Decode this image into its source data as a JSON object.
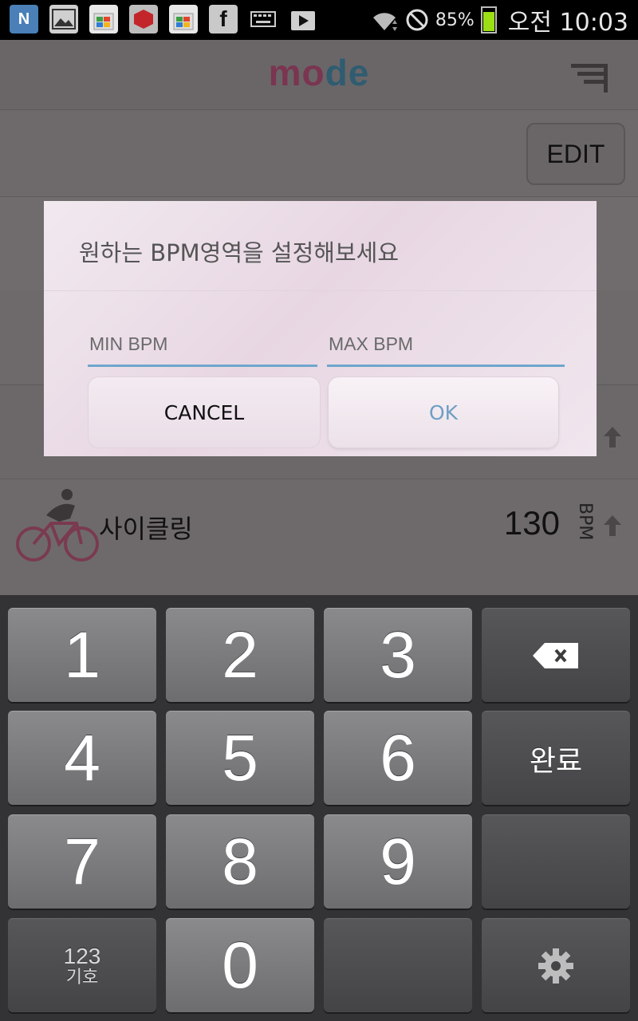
{
  "status_bar": {
    "battery_percent": "85%",
    "time": "오전 10:03",
    "notification_icons": [
      "n-app-icon",
      "gallery-icon",
      "store-icon",
      "cube-app-icon",
      "store-icon",
      "facebook-icon",
      "keyboard-icon",
      "play-store-icon"
    ]
  },
  "app": {
    "logo": "mode",
    "edit_label": "EDIT",
    "activity": {
      "name": "사이클링",
      "bpm": "130",
      "unit": "BPM"
    }
  },
  "dialog": {
    "title": "원하는 BPM영역을 설정해보세요",
    "min_placeholder": "MIN BPM",
    "max_placeholder": "MAX BPM",
    "cancel_label": "CANCEL",
    "ok_label": "OK"
  },
  "keyboard": {
    "k1": "1",
    "k2": "2",
    "k3": "3",
    "k4": "4",
    "k5": "5",
    "k6": "6",
    "k7": "7",
    "k8": "8",
    "k9": "9",
    "k0": "0",
    "done_label": "완료",
    "symbols_label_top": "123",
    "symbols_label_bottom": "기호"
  },
  "colors": {
    "accent_blue": "#6ea6cc",
    "battery_green": "#9ae014",
    "logo_red": "#7a3550",
    "logo_teal": "#2f5c70"
  }
}
